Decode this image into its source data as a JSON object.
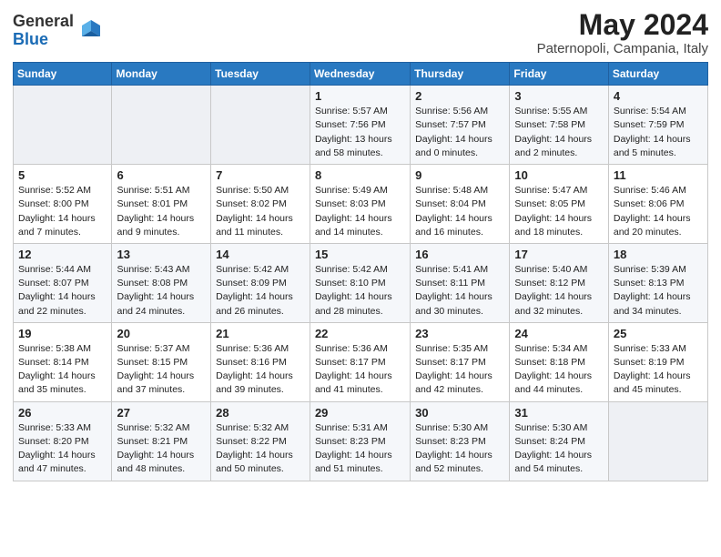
{
  "header": {
    "logo_general": "General",
    "logo_blue": "Blue",
    "month": "May 2024",
    "location": "Paternopoli, Campania, Italy"
  },
  "weekdays": [
    "Sunday",
    "Monday",
    "Tuesday",
    "Wednesday",
    "Thursday",
    "Friday",
    "Saturday"
  ],
  "weeks": [
    [
      {
        "day": "",
        "content": ""
      },
      {
        "day": "",
        "content": ""
      },
      {
        "day": "",
        "content": ""
      },
      {
        "day": "1",
        "content": "Sunrise: 5:57 AM\nSunset: 7:56 PM\nDaylight: 13 hours\nand 58 minutes."
      },
      {
        "day": "2",
        "content": "Sunrise: 5:56 AM\nSunset: 7:57 PM\nDaylight: 14 hours\nand 0 minutes."
      },
      {
        "day": "3",
        "content": "Sunrise: 5:55 AM\nSunset: 7:58 PM\nDaylight: 14 hours\nand 2 minutes."
      },
      {
        "day": "4",
        "content": "Sunrise: 5:54 AM\nSunset: 7:59 PM\nDaylight: 14 hours\nand 5 minutes."
      }
    ],
    [
      {
        "day": "5",
        "content": "Sunrise: 5:52 AM\nSunset: 8:00 PM\nDaylight: 14 hours\nand 7 minutes."
      },
      {
        "day": "6",
        "content": "Sunrise: 5:51 AM\nSunset: 8:01 PM\nDaylight: 14 hours\nand 9 minutes."
      },
      {
        "day": "7",
        "content": "Sunrise: 5:50 AM\nSunset: 8:02 PM\nDaylight: 14 hours\nand 11 minutes."
      },
      {
        "day": "8",
        "content": "Sunrise: 5:49 AM\nSunset: 8:03 PM\nDaylight: 14 hours\nand 14 minutes."
      },
      {
        "day": "9",
        "content": "Sunrise: 5:48 AM\nSunset: 8:04 PM\nDaylight: 14 hours\nand 16 minutes."
      },
      {
        "day": "10",
        "content": "Sunrise: 5:47 AM\nSunset: 8:05 PM\nDaylight: 14 hours\nand 18 minutes."
      },
      {
        "day": "11",
        "content": "Sunrise: 5:46 AM\nSunset: 8:06 PM\nDaylight: 14 hours\nand 20 minutes."
      }
    ],
    [
      {
        "day": "12",
        "content": "Sunrise: 5:44 AM\nSunset: 8:07 PM\nDaylight: 14 hours\nand 22 minutes."
      },
      {
        "day": "13",
        "content": "Sunrise: 5:43 AM\nSunset: 8:08 PM\nDaylight: 14 hours\nand 24 minutes."
      },
      {
        "day": "14",
        "content": "Sunrise: 5:42 AM\nSunset: 8:09 PM\nDaylight: 14 hours\nand 26 minutes."
      },
      {
        "day": "15",
        "content": "Sunrise: 5:42 AM\nSunset: 8:10 PM\nDaylight: 14 hours\nand 28 minutes."
      },
      {
        "day": "16",
        "content": "Sunrise: 5:41 AM\nSunset: 8:11 PM\nDaylight: 14 hours\nand 30 minutes."
      },
      {
        "day": "17",
        "content": "Sunrise: 5:40 AM\nSunset: 8:12 PM\nDaylight: 14 hours\nand 32 minutes."
      },
      {
        "day": "18",
        "content": "Sunrise: 5:39 AM\nSunset: 8:13 PM\nDaylight: 14 hours\nand 34 minutes."
      }
    ],
    [
      {
        "day": "19",
        "content": "Sunrise: 5:38 AM\nSunset: 8:14 PM\nDaylight: 14 hours\nand 35 minutes."
      },
      {
        "day": "20",
        "content": "Sunrise: 5:37 AM\nSunset: 8:15 PM\nDaylight: 14 hours\nand 37 minutes."
      },
      {
        "day": "21",
        "content": "Sunrise: 5:36 AM\nSunset: 8:16 PM\nDaylight: 14 hours\nand 39 minutes."
      },
      {
        "day": "22",
        "content": "Sunrise: 5:36 AM\nSunset: 8:17 PM\nDaylight: 14 hours\nand 41 minutes."
      },
      {
        "day": "23",
        "content": "Sunrise: 5:35 AM\nSunset: 8:17 PM\nDaylight: 14 hours\nand 42 minutes."
      },
      {
        "day": "24",
        "content": "Sunrise: 5:34 AM\nSunset: 8:18 PM\nDaylight: 14 hours\nand 44 minutes."
      },
      {
        "day": "25",
        "content": "Sunrise: 5:33 AM\nSunset: 8:19 PM\nDaylight: 14 hours\nand 45 minutes."
      }
    ],
    [
      {
        "day": "26",
        "content": "Sunrise: 5:33 AM\nSunset: 8:20 PM\nDaylight: 14 hours\nand 47 minutes."
      },
      {
        "day": "27",
        "content": "Sunrise: 5:32 AM\nSunset: 8:21 PM\nDaylight: 14 hours\nand 48 minutes."
      },
      {
        "day": "28",
        "content": "Sunrise: 5:32 AM\nSunset: 8:22 PM\nDaylight: 14 hours\nand 50 minutes."
      },
      {
        "day": "29",
        "content": "Sunrise: 5:31 AM\nSunset: 8:23 PM\nDaylight: 14 hours\nand 51 minutes."
      },
      {
        "day": "30",
        "content": "Sunrise: 5:30 AM\nSunset: 8:23 PM\nDaylight: 14 hours\nand 52 minutes."
      },
      {
        "day": "31",
        "content": "Sunrise: 5:30 AM\nSunset: 8:24 PM\nDaylight: 14 hours\nand 54 minutes."
      },
      {
        "day": "",
        "content": ""
      }
    ]
  ]
}
